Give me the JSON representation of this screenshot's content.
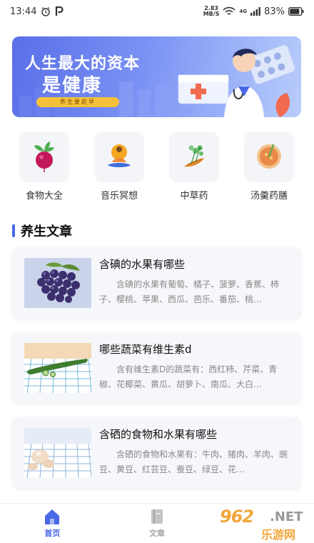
{
  "status_bar": {
    "time": "13:44",
    "net_speed_value": "2.83",
    "net_speed_unit": "MB/S",
    "signal_type": "4G",
    "battery": "83%"
  },
  "banner": {
    "title_line1": "人生最大的资本",
    "title_line2": "是健康",
    "pill_text": "养生要趁早"
  },
  "categories": [
    {
      "label": "食物大全",
      "icon": "radish-icon"
    },
    {
      "label": "音乐冥想",
      "icon": "meditation-icon"
    },
    {
      "label": "中草药",
      "icon": "herb-icon"
    },
    {
      "label": "汤羹药膳",
      "icon": "soup-icon"
    }
  ],
  "section": {
    "title": "养生文章"
  },
  "articles": [
    {
      "title": "含碘的水果有哪些",
      "desc": "含碘的水果有葡萄、橘子、菠萝、香蕉、柿子、樱桃、苹果、西瓜、芭乐、番茄、桃…"
    },
    {
      "title": "哪些蔬菜有维生素d",
      "desc": "含有维生素D的蔬菜有：西红柿、芹菜、青椒、花椰菜、黄瓜、胡萝卜、南瓜、大白…"
    },
    {
      "title": "含硒的食物和水果有哪些",
      "desc": "含硒的食物和水果有：牛肉、猪肉、羊肉、豌豆、黄豆、红芸豆、蚕豆、绿豆、花…"
    }
  ],
  "bottom_nav": [
    {
      "label": "首页",
      "active": true
    },
    {
      "label": "文章",
      "active": false
    }
  ],
  "watermark": {
    "num": "962",
    "net": ".NET",
    "cn": "乐游网"
  },
  "colors": {
    "accent": "#4a68e6",
    "banner_start": "#5a6fe8",
    "banner_end": "#b8cdfb",
    "card_bg": "#f6f7fa"
  }
}
